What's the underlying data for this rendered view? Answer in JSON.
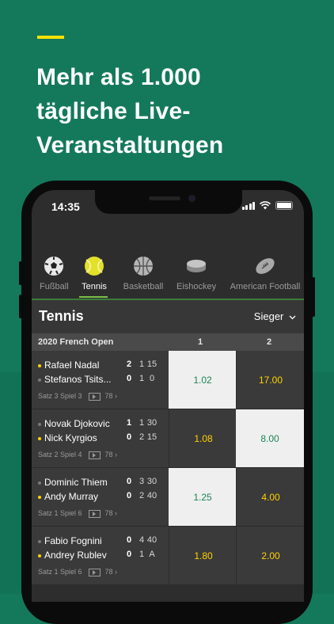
{
  "headline": {
    "lines": [
      "Mehr als 1.000",
      "tägliche Live-",
      "Veranstaltungen"
    ]
  },
  "status_bar": {
    "time": "14:35"
  },
  "sports": [
    {
      "label": "Fußball",
      "icon": "soccer-ball-icon"
    },
    {
      "label": "Tennis",
      "icon": "tennis-ball-icon",
      "active": true
    },
    {
      "label": "Basketball",
      "icon": "basketball-icon"
    },
    {
      "label": "Eishockey",
      "icon": "hockey-puck-icon"
    },
    {
      "label": "American Football",
      "icon": "american-football-icon"
    }
  ],
  "section": {
    "title": "Tennis",
    "market": "Sieger",
    "market_icon": "chevron-down-icon"
  },
  "competition": {
    "name": "2020 French Open",
    "col1": "1",
    "col2": "2"
  },
  "matches": [
    {
      "p1": {
        "name": "Rafael Nadal",
        "serving": true,
        "sets": "2",
        "games": "1",
        "points": "15"
      },
      "p2": {
        "name": "Stefanos Tsits...",
        "serving": false,
        "sets": "0",
        "games": "1",
        "points": "0"
      },
      "status": "Satz 3 Spiel 3",
      "markets": "78 ›",
      "odds": [
        "1.02",
        "17.00"
      ],
      "highlight": 0
    },
    {
      "p1": {
        "name": "Novak Djokovic",
        "serving": false,
        "sets": "1",
        "games": "1",
        "points": "30"
      },
      "p2": {
        "name": "Nick Kyrgios",
        "serving": true,
        "sets": "0",
        "games": "2",
        "points": "15"
      },
      "status": "Satz 2 Spiel 4",
      "markets": "78 ›",
      "odds": [
        "1.08",
        "8.00"
      ],
      "highlight": 1
    },
    {
      "p1": {
        "name": "Dominic Thiem",
        "serving": false,
        "sets": "0",
        "games": "3",
        "points": "30"
      },
      "p2": {
        "name": "Andy Murray",
        "serving": true,
        "sets": "0",
        "games": "2",
        "points": "40"
      },
      "status": "Satz 1 Spiel 6",
      "markets": "78 ›",
      "odds": [
        "1.25",
        "4.00"
      ],
      "highlight": 0
    },
    {
      "p1": {
        "name": "Fabio Fognini",
        "serving": false,
        "sets": "0",
        "games": "4",
        "points": "40"
      },
      "p2": {
        "name": "Andrey Rublev",
        "serving": true,
        "sets": "0",
        "games": "1",
        "points": "A"
      },
      "status": "Satz 1 Spiel 6",
      "markets": "78 ›",
      "odds": [
        "1.80",
        "2.00"
      ],
      "highlight": -1
    }
  ],
  "colors": {
    "background": "#14795a",
    "accent_yellow": "#ffe000",
    "odds_green": "#1a8456",
    "odds_yellow": "#ffd200"
  }
}
